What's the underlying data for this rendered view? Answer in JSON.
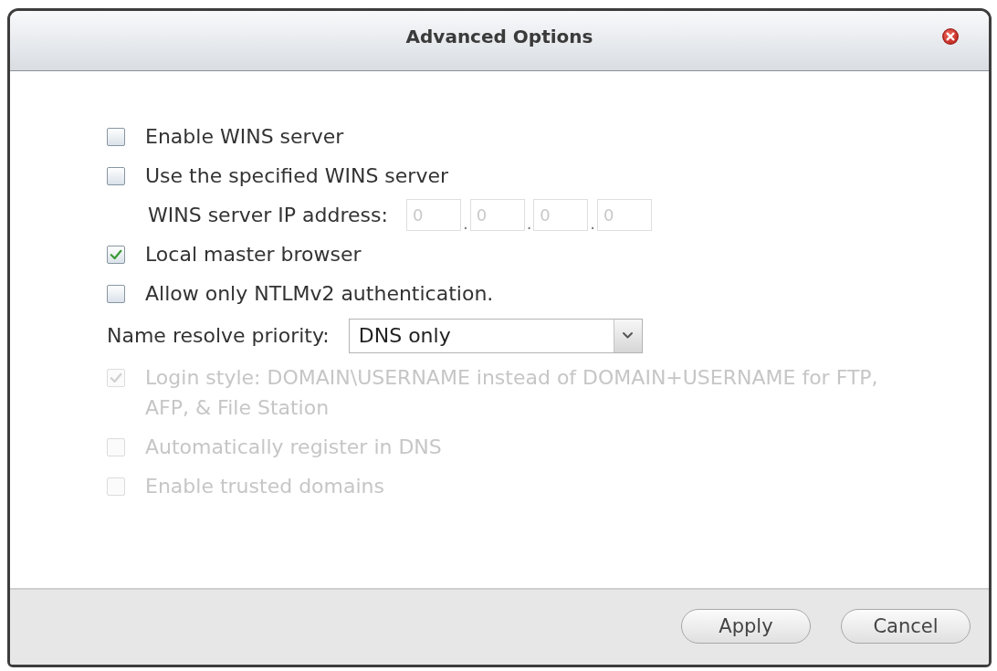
{
  "window": {
    "title": "Advanced Options"
  },
  "options": [
    {
      "kind": "checkbox",
      "label": "Enable WINS server",
      "checked": false,
      "disabled": false
    },
    {
      "kind": "checkbox",
      "label": "Use the specified WINS server",
      "checked": false,
      "disabled": false
    },
    {
      "kind": "ip",
      "label": "WINS server IP address:",
      "octets": [
        {
          "value": "0",
          "disabled": true
        },
        {
          "separator": ".",
          "value": "0",
          "disabled": true
        },
        {
          "separator": ".",
          "value": "0",
          "disabled": true
        },
        {
          "separator": ".",
          "value": "0",
          "disabled": true
        }
      ]
    },
    {
      "kind": "checkbox",
      "label": "Local master browser",
      "checked": true,
      "disabled": false
    },
    {
      "kind": "checkbox",
      "label": "Allow only NTLMv2 authentication.",
      "checked": false,
      "disabled": false
    },
    {
      "kind": "select",
      "label": "Name resolve priority:",
      "value": "DNS only"
    },
    {
      "kind": "checkbox",
      "label": "Login style: DOMAIN\\USERNAME instead of DOMAIN+USERNAME for FTP, AFP, & File Station",
      "checked": true,
      "disabled": true
    },
    {
      "kind": "checkbox",
      "label": "Automatically register in DNS",
      "checked": false,
      "disabled": true
    },
    {
      "kind": "checkbox",
      "label": "Enable trusted domains",
      "checked": false,
      "disabled": true
    }
  ],
  "buttons": [
    {
      "label": "Apply"
    },
    {
      "label": "Cancel"
    }
  ]
}
